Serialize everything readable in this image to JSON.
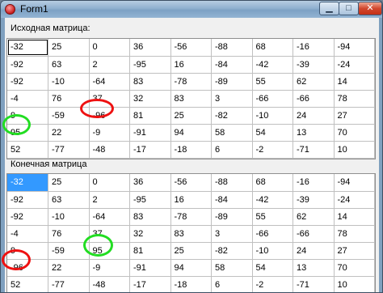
{
  "window": {
    "title": "Form1",
    "minimize": "▁",
    "maximize": "□",
    "close": "✕"
  },
  "colors": {
    "highlight_red": "#ee1111",
    "highlight_green": "#22dd22",
    "selection": "#3399ff"
  },
  "source": {
    "label": "Исходная матрица:",
    "rows": [
      [
        "-32",
        "25",
        "0",
        "36",
        "-56",
        "-88",
        "68",
        "-16",
        "-94"
      ],
      [
        "-92",
        "63",
        "2",
        "-95",
        "16",
        "-84",
        "-42",
        "-39",
        "-24"
      ],
      [
        "-92",
        "-10",
        "-64",
        "83",
        "-78",
        "-89",
        "55",
        "62",
        "14"
      ],
      [
        "-4",
        "76",
        "37",
        "32",
        "83",
        "3",
        "-66",
        "-66",
        "78"
      ],
      [
        "9",
        "-59",
        "-96",
        "81",
        "25",
        "-82",
        "-10",
        "24",
        "27"
      ],
      [
        "95",
        "22",
        "-9",
        "-91",
        "94",
        "58",
        "54",
        "13",
        "70"
      ],
      [
        "52",
        "-77",
        "-48",
        "-17",
        "-18",
        "6",
        "-2",
        "-71",
        "10"
      ]
    ]
  },
  "result": {
    "label": "Конечная матрица",
    "rows": [
      [
        "-32",
        "25",
        "0",
        "36",
        "-56",
        "-88",
        "68",
        "-16",
        "-94"
      ],
      [
        "-92",
        "63",
        "2",
        "-95",
        "16",
        "-84",
        "-42",
        "-39",
        "-24"
      ],
      [
        "-92",
        "-10",
        "-64",
        "83",
        "-78",
        "-89",
        "55",
        "62",
        "14"
      ],
      [
        "-4",
        "76",
        "37",
        "32",
        "83",
        "3",
        "-66",
        "-66",
        "78"
      ],
      [
        "9",
        "-59",
        "95",
        "81",
        "25",
        "-82",
        "-10",
        "24",
        "27"
      ],
      [
        "-96",
        "22",
        "-9",
        "-91",
        "94",
        "58",
        "54",
        "13",
        "70"
      ],
      [
        "52",
        "-77",
        "-48",
        "-17",
        "-18",
        "6",
        "-2",
        "-71",
        "10"
      ]
    ]
  }
}
